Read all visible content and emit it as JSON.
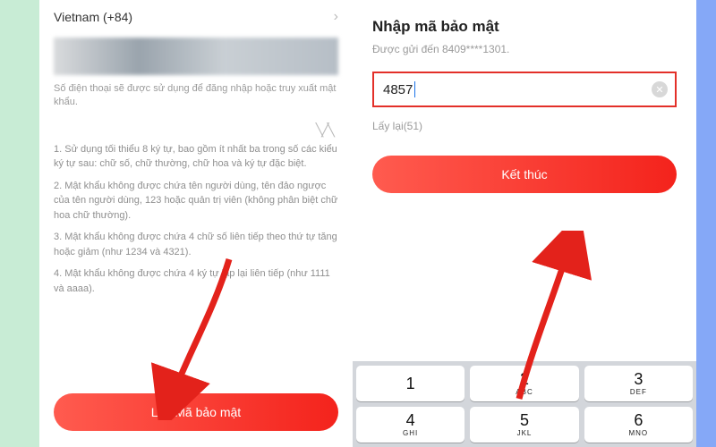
{
  "left": {
    "country_label": "Vietnam  (+84)",
    "phone_hint": "Số điện thoại sẽ được sử dụng để đăng nhập hoặc truy xuất mật khẩu.",
    "rules": [
      "1. Sử dụng tối thiểu 8 ký tự, bao gồm ít nhất ba trong số các kiểu ký tự sau: chữ số, chữ thường, chữ hoa và ký tự đặc biệt.",
      "2. Mật khẩu không được chứa tên người dùng, tên đảo ngược của tên người dùng, 123 hoặc quản trị viên (không phân biệt chữ hoa chữ thường).",
      "3. Mật khẩu không được chứa 4 chữ số liên tiếp theo thứ tự tăng hoặc giảm (như 1234 và 4321).",
      "4. Mật khẩu không được chứa 4 ký tự lặp lại liên tiếp (như 1111 và aaaa)."
    ],
    "submit_label": "Lấy Mã bảo mật"
  },
  "right": {
    "title": "Nhập mã bảo mật",
    "sent_text": "Được gửi đến 8409****1301.",
    "code_value": "4857",
    "resend_text": "Lấy lại(51)",
    "finish_label": "Kết thúc",
    "keypad": [
      {
        "num": "1",
        "letters": ""
      },
      {
        "num": "2",
        "letters": "ABC"
      },
      {
        "num": "3",
        "letters": "DEF"
      },
      {
        "num": "4",
        "letters": "GHI"
      },
      {
        "num": "5",
        "letters": "JKL"
      },
      {
        "num": "6",
        "letters": "MNO"
      }
    ]
  }
}
